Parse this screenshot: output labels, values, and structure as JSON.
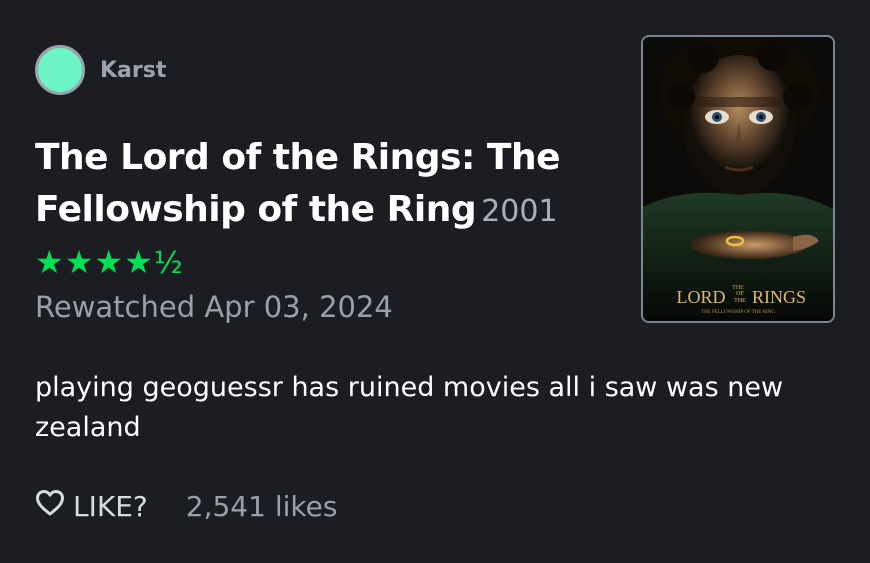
{
  "author": {
    "name": "Karst",
    "avatar_color": "#6df4c5"
  },
  "film": {
    "title": "The Lord of the Rings: The Fellowship of the Ring",
    "year": "2001",
    "rating_stars": "★★★★",
    "rating_half": "½",
    "rating_value": 4.5
  },
  "watch": {
    "date_text": "Rewatched Apr 03, 2024"
  },
  "review": {
    "text": "playing geoguessr has ruined movies all i saw was new zealand"
  },
  "actions": {
    "like_label": "LIKE?",
    "likes_count": "2,541 likes"
  },
  "poster": {
    "logo_the": "THE",
    "logo_main_left": "LORD",
    "logo_of": "OF",
    "logo_the2": "THE",
    "logo_main_right": "RINGS",
    "logo_subtitle": "THE FELLOWSHIP OF THE RING"
  },
  "colors": {
    "background": "#1b1d23",
    "accent_green": "#00e054",
    "muted_text": "#98a1ab"
  }
}
